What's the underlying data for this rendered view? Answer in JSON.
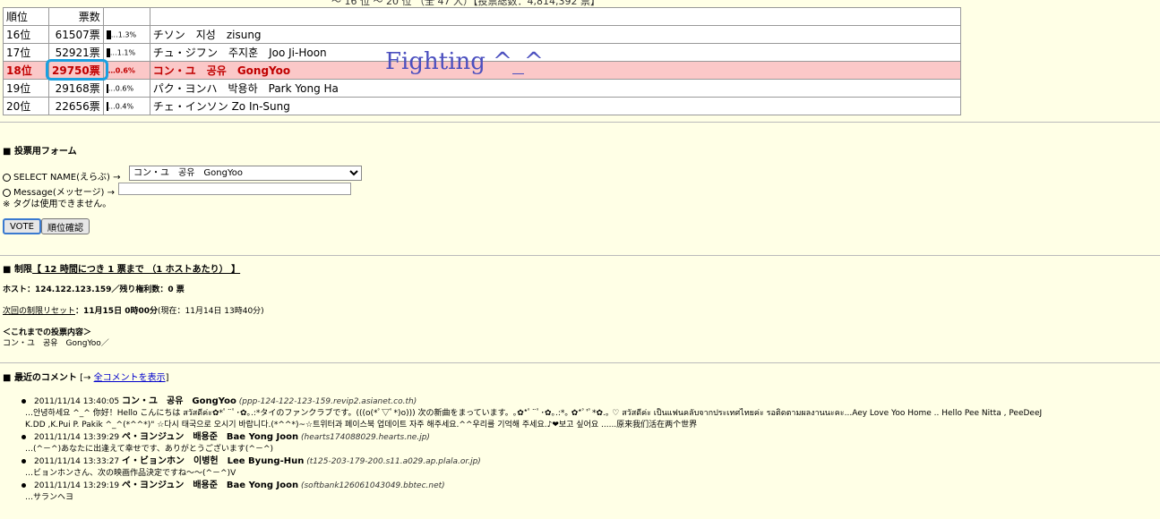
{
  "header": {
    "top_text": "～ 16 位 ～ 20 位 （全 47 人）【投票総数：4,814,392 票】"
  },
  "ranking_table": {
    "columns": [
      "順位",
      "票数",
      ""
    ],
    "rows": [
      {
        "rank": "16位",
        "votes": "61507票",
        "pct": "1.3%",
        "bar": 1.3,
        "name": "チソン　지성　zisung",
        "highlight": false
      },
      {
        "rank": "17位",
        "votes": "52921票",
        "pct": "1.1%",
        "bar": 1.1,
        "name": "チュ・ジフン　주지훈　Joo Ji-Hoon",
        "highlight": false
      },
      {
        "rank": "18位",
        "votes": "29750票",
        "pct": "0.6%",
        "bar": 0.6,
        "name": "コン・ユ　공유　GongYoo",
        "highlight": true
      },
      {
        "rank": "19位",
        "votes": "29168票",
        "pct": "0.6%",
        "bar": 0.6,
        "name": "パク・ヨンハ　박용하　Park Yong Ha",
        "highlight": false
      },
      {
        "rank": "20位",
        "votes": "22656票",
        "pct": "0.4%",
        "bar": 0.4,
        "name": "チェ・インソン Zo In-Sung",
        "highlight": false
      }
    ]
  },
  "overlay": {
    "fighting_text": "Fighting ^_^"
  },
  "vote_form": {
    "heading": "投票用フォーム",
    "select_label": "SELECT NAME(えらぶ) →",
    "selected_name": "コン・ユ　공유　GongYoo",
    "message_label": "Message(メッセージ) →",
    "message_value": "",
    "tag_note": "※ タグは使用できません。",
    "vote_button": "VOTE",
    "rank_button": "順位確認"
  },
  "limits": {
    "heading": "制限",
    "rule": "【 12 時間につき 1 票まで （1 ホストあたり） 】",
    "host_line": "ホスト：124.122.123.159／残り権利数：0 票",
    "reset_label": "次回の制限リセット",
    "reset_value": "：11月15日 0時00分",
    "reset_now": "(現在：11月14日 13時40分)",
    "history_heading": "＜これまでの投票内容＞",
    "history_value": "コン・ユ　공유　GongYoo／"
  },
  "comments": {
    "heading": "最近のコメント",
    "link_prefix": "[→ ",
    "link_text": "全コメントを表示",
    "link_suffix": "]",
    "items": [
      {
        "time": "2011/11/14 13:40:05",
        "name": "コン・ユ　공유　GongYoo",
        "host": "(ppp-124-122-123-159.revip2.asianet.co.th)",
        "body1": "…안녕하세요 ^_^ 你好！Hello こんにちは สวัสดีค่ะ✿*ﾟ¨ﾟ･✿｡.:*タイのファンクラブです。(((o(*ﾟ▽ﾟ*)o))) 次の新曲をまっています。｡✿*ﾟ¨ﾟ･✿｡.:*｡ ✿*ﾟ'ﾟ*✿.｡ ♡ สวัสดีค่ะ เป็นแฟนคลับจากประเทศไทยค่ะ รอติดตามผลงานนะคะ...Aey Love Yoo Home .. Hello Pee Nitta , PeeDeeJ",
        "body2": "K.DD ,K.Pui P. Pakik ^_^(*^^*)\" ☆다시 태국으로 오시기 바랍니다.(*^^*)~☆트위터과 페이스북 업데이트 자주 해주세요.^^우리를 기억해 주세요.♪❤보고 싶어요 ......原来我们活在两个世界"
      },
      {
        "time": "2011/11/14 13:39:29",
        "name": "ペ・ヨンジュン　배용준　Bae Yong Joon",
        "host": "(hearts174088029.hearts.ne.jp)",
        "body1": "…(^－^)あなたに出逢えて幸せです、ありがとうございます(^－^)",
        "body2": ""
      },
      {
        "time": "2011/11/14 13:33:27",
        "name": "イ・ビョンホン　이병헌　Lee Byung-Hun",
        "host": "(t125-203-179-200.s11.a029.ap.plala.or.jp)",
        "body1": "…ビョンホンさん、次の映画作品決定ですね～～(^－^)V",
        "body2": ""
      },
      {
        "time": "2011/11/14 13:29:19",
        "name": "ペ・ヨンジュン　배용준　Bae Yong Joon",
        "host": "(softbank126061043049.bbtec.net)",
        "body1": "…サランヘヨ",
        "body2": ""
      }
    ]
  }
}
